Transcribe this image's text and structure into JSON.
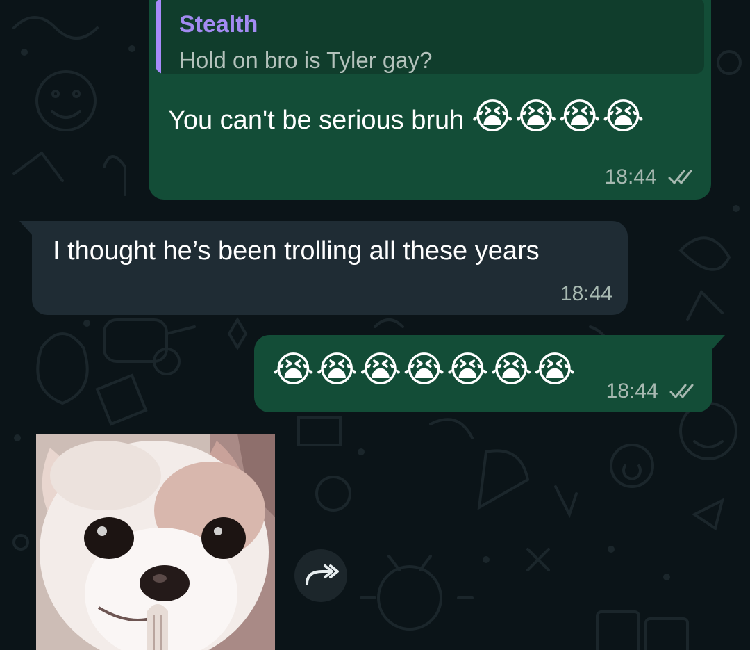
{
  "messages": [
    {
      "direction": "outgoing",
      "reply": {
        "name": "Stealth",
        "text": "Hold on bro is Tyler gay?"
      },
      "text": "You can't be serious bruh",
      "emoji": "😭😭😭😭",
      "time": "18:44",
      "status_icon": "double-check-icon"
    },
    {
      "direction": "incoming",
      "text": "I thought he’s been trolling all these years",
      "time": "18:44"
    },
    {
      "direction": "outgoing",
      "emoji": "😭😭😭😭😭😭😭",
      "time": "18:44",
      "status_icon": "double-check-icon"
    },
    {
      "direction": "incoming",
      "type": "sticker",
      "sticker_subject": "chihuahua-pleading",
      "action_icon": "forward-icon"
    }
  ],
  "colors": {
    "background": "#0b1418",
    "outgoing_bubble": "#134d37",
    "incoming_bubble": "#1f2c34",
    "quote_accent": "#a78bfa",
    "meta_text": "#a7b9b1"
  }
}
